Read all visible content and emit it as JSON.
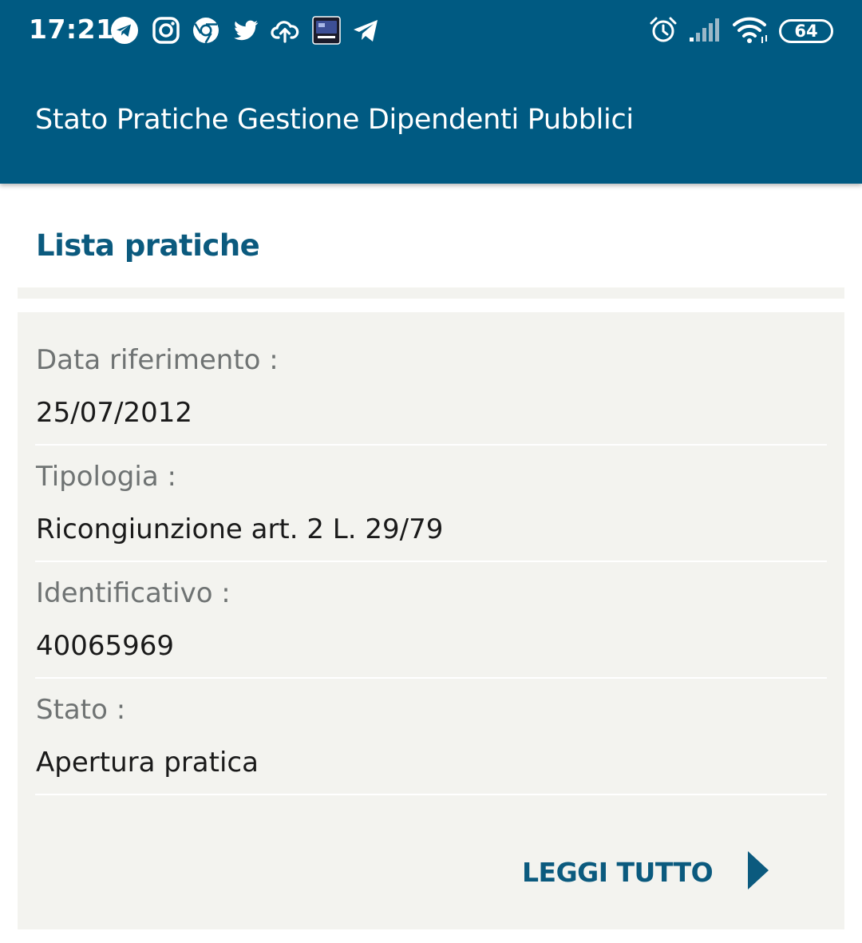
{
  "status_bar": {
    "time": "17:21",
    "battery_level": "64",
    "notification_icons": [
      "telegram-icon",
      "instagram-icon",
      "chrome-icon",
      "twitter-icon",
      "cloud-upload-icon",
      "panasonic-app-icon",
      "telegram-plane-icon"
    ],
    "system_icons": [
      "alarm-icon",
      "signal-icon",
      "wifi-icon",
      "battery-icon"
    ]
  },
  "app_bar": {
    "title": "Stato Pratiche Gestione Dipendenti Pubblici"
  },
  "page": {
    "section_title": "Lista pratiche"
  },
  "practice": {
    "fields": [
      {
        "label": "Data riferimento :",
        "value": "25/07/2012"
      },
      {
        "label": "Tipologia :",
        "value": "Ricongiunzione art. 2 L. 29/79"
      },
      {
        "label": "Identificativo :",
        "value": "40065969"
      },
      {
        "label": "Stato :",
        "value": "Apertura pratica"
      }
    ],
    "read_more_label": "LEGGI TUTTO"
  },
  "colors": {
    "header_bg": "#005a82",
    "accent": "#0b5a7e",
    "card_bg": "#f3f3ef",
    "label_text": "#6f7373",
    "value_text": "#1a1a1a"
  }
}
